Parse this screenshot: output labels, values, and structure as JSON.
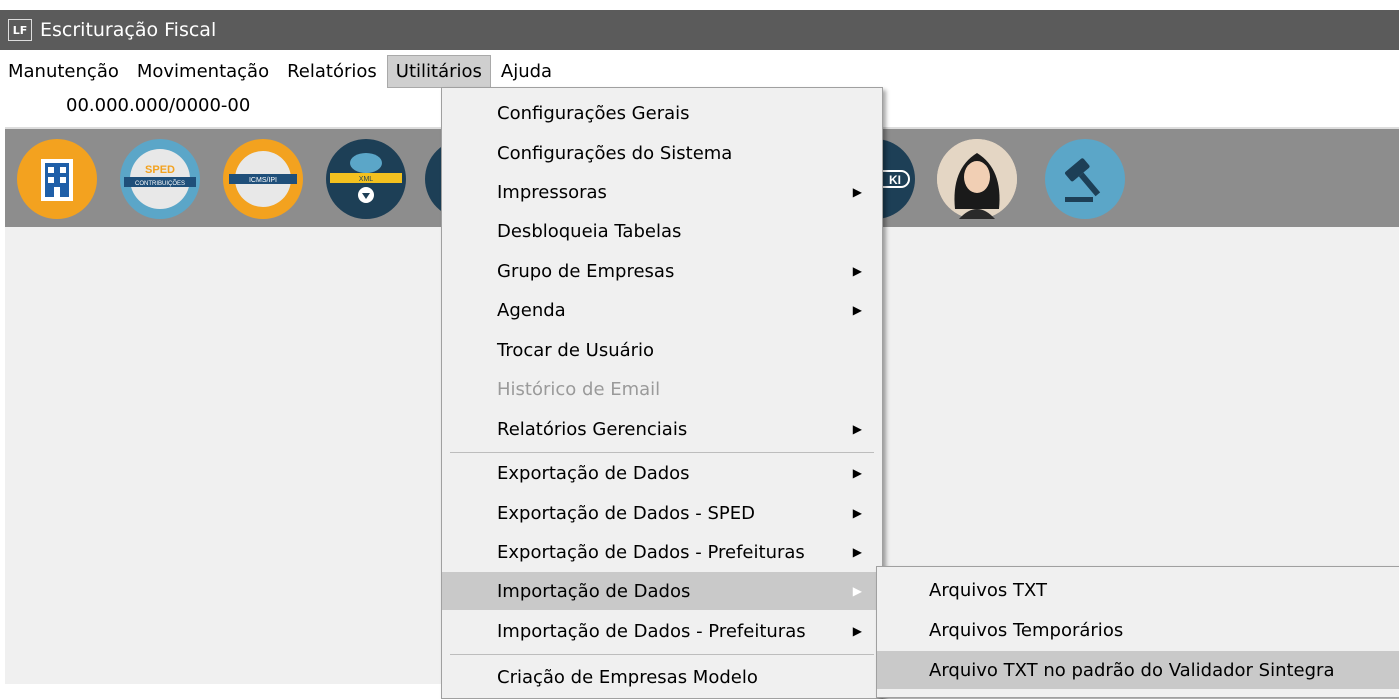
{
  "window": {
    "icon_text": "LF",
    "title": "Escrituração Fiscal"
  },
  "menubar": {
    "items": [
      "Manutenção",
      "Movimentação",
      "Relatórios",
      "Utilitários",
      "Ajuda"
    ]
  },
  "cnpj": "00.000.000/0000-00",
  "toolbar": {
    "buttons": [
      {
        "name": "empresa-icon",
        "label": ""
      },
      {
        "name": "sped-contribuicoes-icon",
        "label_top": "SPED",
        "label": "CONTRIBUIÇÕES"
      },
      {
        "name": "icms-ipi-icon",
        "label": "ICMS/IPI"
      },
      {
        "name": "xml-cloud-icon",
        "label": "XML"
      },
      {
        "name": "partial-icon",
        "label": ""
      },
      {
        "name": "ki-icon",
        "label": "KI"
      },
      {
        "name": "assistant-avatar-icon",
        "label": ""
      },
      {
        "name": "gavel-icon",
        "label": ""
      }
    ]
  },
  "utilitarios_menu": {
    "items": [
      {
        "label": "Configurações Gerais",
        "submenu": false
      },
      {
        "label": "Configurações do Sistema",
        "submenu": false
      },
      {
        "label": "Impressoras",
        "submenu": true
      },
      {
        "label": "Desbloqueia Tabelas",
        "submenu": false
      },
      {
        "label": "Grupo de Empresas",
        "submenu": true
      },
      {
        "label": "Agenda",
        "submenu": true
      },
      {
        "label": "Trocar de Usuário",
        "submenu": false
      },
      {
        "label": "Histórico de Email",
        "submenu": false,
        "disabled": true
      },
      {
        "label": "Relatórios Gerenciais",
        "submenu": true
      },
      {
        "label": "Exportação de Dados",
        "submenu": true
      },
      {
        "label": "Exportação de Dados - SPED",
        "submenu": true
      },
      {
        "label": "Exportação de Dados - Prefeituras",
        "submenu": true
      },
      {
        "label": "Importação de Dados",
        "submenu": true,
        "highlighted": true
      },
      {
        "label": "Importação de Dados - Prefeituras",
        "submenu": true
      },
      {
        "label": "Criação de Empresas Modelo",
        "submenu": false
      }
    ],
    "arrow": "▶"
  },
  "importacao_submenu": {
    "items": [
      {
        "label": "Arquivos TXT"
      },
      {
        "label": "Arquivos Temporários"
      },
      {
        "label": "Arquivo TXT no padrão do Validador Sintegra",
        "highlighted": true
      }
    ]
  },
  "colors": {
    "titlebar": "#5b5b5b",
    "toolbar": "#8d8d8d",
    "menu_bg": "#f0f0f0",
    "highlight": "#c9c9c9"
  }
}
